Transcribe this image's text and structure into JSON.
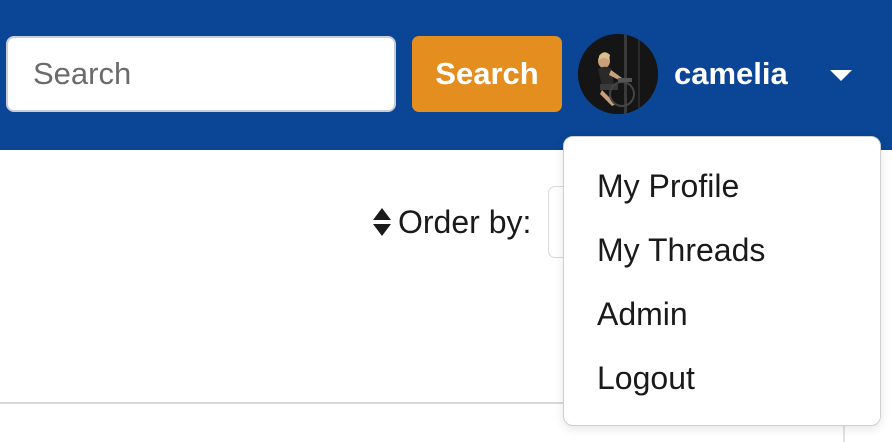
{
  "header": {
    "background_color": "#0a4596",
    "search": {
      "placeholder": "Search",
      "value": "",
      "button_label": "Search",
      "button_color": "#e38e1e"
    },
    "user": {
      "username": "camelia",
      "avatar_icon": "user-avatar-photo",
      "caret_icon": "caret-down-icon"
    }
  },
  "dropdown": {
    "items": [
      {
        "label": "My Profile"
      },
      {
        "label": "My Threads"
      },
      {
        "label": "Admin"
      },
      {
        "label": "Logout"
      }
    ]
  },
  "toolbar": {
    "order_label": "Order by:",
    "sort_icon": "sort-icon"
  }
}
